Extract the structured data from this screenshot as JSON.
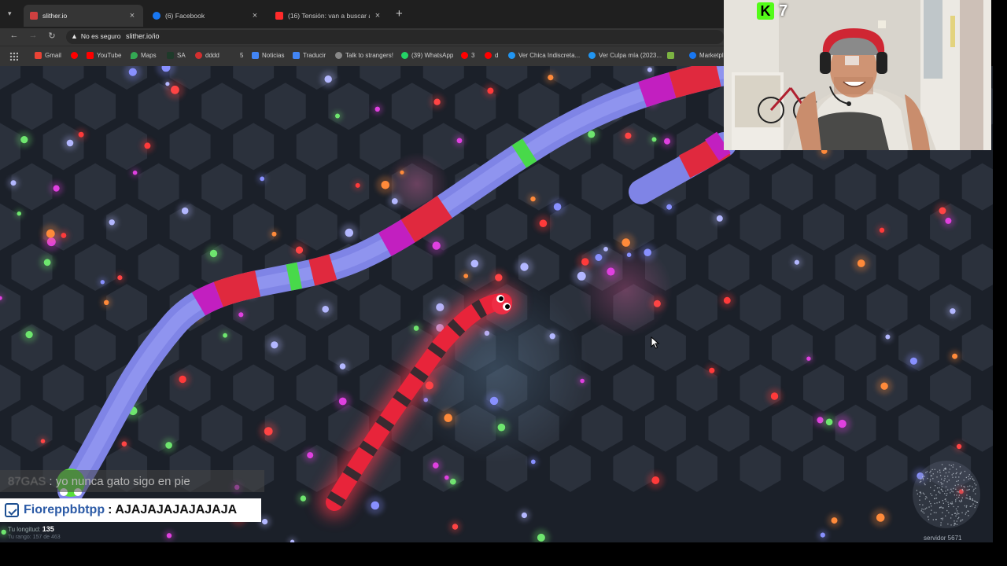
{
  "browser": {
    "tabs": [
      {
        "title": "slither.io",
        "favicon_color": "#d04040",
        "active": true
      },
      {
        "title": "(6) Facebook",
        "favicon_color": "#1877f2",
        "active": false
      },
      {
        "title": "(16) Tensión: van a buscar al al",
        "favicon_color": "#ff2a2a",
        "active": false
      }
    ],
    "new_tab": "+",
    "security_label": "No es seguro",
    "url": "slither.io/io",
    "bookmarks": [
      {
        "label": "Gmail",
        "color": "#ea4335"
      },
      {
        "label": "",
        "color": "#ff0000"
      },
      {
        "label": "YouTube",
        "color": "#ff0000"
      },
      {
        "label": "Maps",
        "color": "#34a853"
      },
      {
        "label": "SA",
        "color": "#6a1b9a"
      },
      {
        "label": "dddd",
        "color": "#d32f2f"
      },
      {
        "label": "5",
        "color": "#444"
      },
      {
        "label": "Noticias",
        "color": "#4285f4"
      },
      {
        "label": "Traducir",
        "color": "#4285f4"
      },
      {
        "label": "Talk to strangers!",
        "color": "#888888"
      },
      {
        "label": "(39) WhatsApp",
        "color": "#25d366"
      },
      {
        "label": "3",
        "color": "#ff0000"
      },
      {
        "label": "d",
        "color": "#ff0000"
      },
      {
        "label": "Ver Chica Indiscreta...",
        "color": "#2196f3"
      },
      {
        "label": "Ver Culpa mía (2023...",
        "color": "#2196f3"
      },
      {
        "label": "",
        "color": "#7cb342"
      },
      {
        "label": "Marketpl",
        "color": "#1877f2"
      }
    ]
  },
  "stream": {
    "viewer_count": "7",
    "chat_ghost_name": "87GAS",
    "chat_ghost_text": ": yo nunca gato sigo en pie",
    "chat_user": "Fioreppbbtpp",
    "chat_sep": ":",
    "chat_text": "AJAJAJAJAJAJAJA"
  },
  "game": {
    "length_label": "Tu longitud:",
    "length_value": "135",
    "rank_text": "Tu rango: 157 de 463",
    "server_text": "servidor 5671",
    "background_color": "#1b2029",
    "hex_color": "#2b313c"
  }
}
